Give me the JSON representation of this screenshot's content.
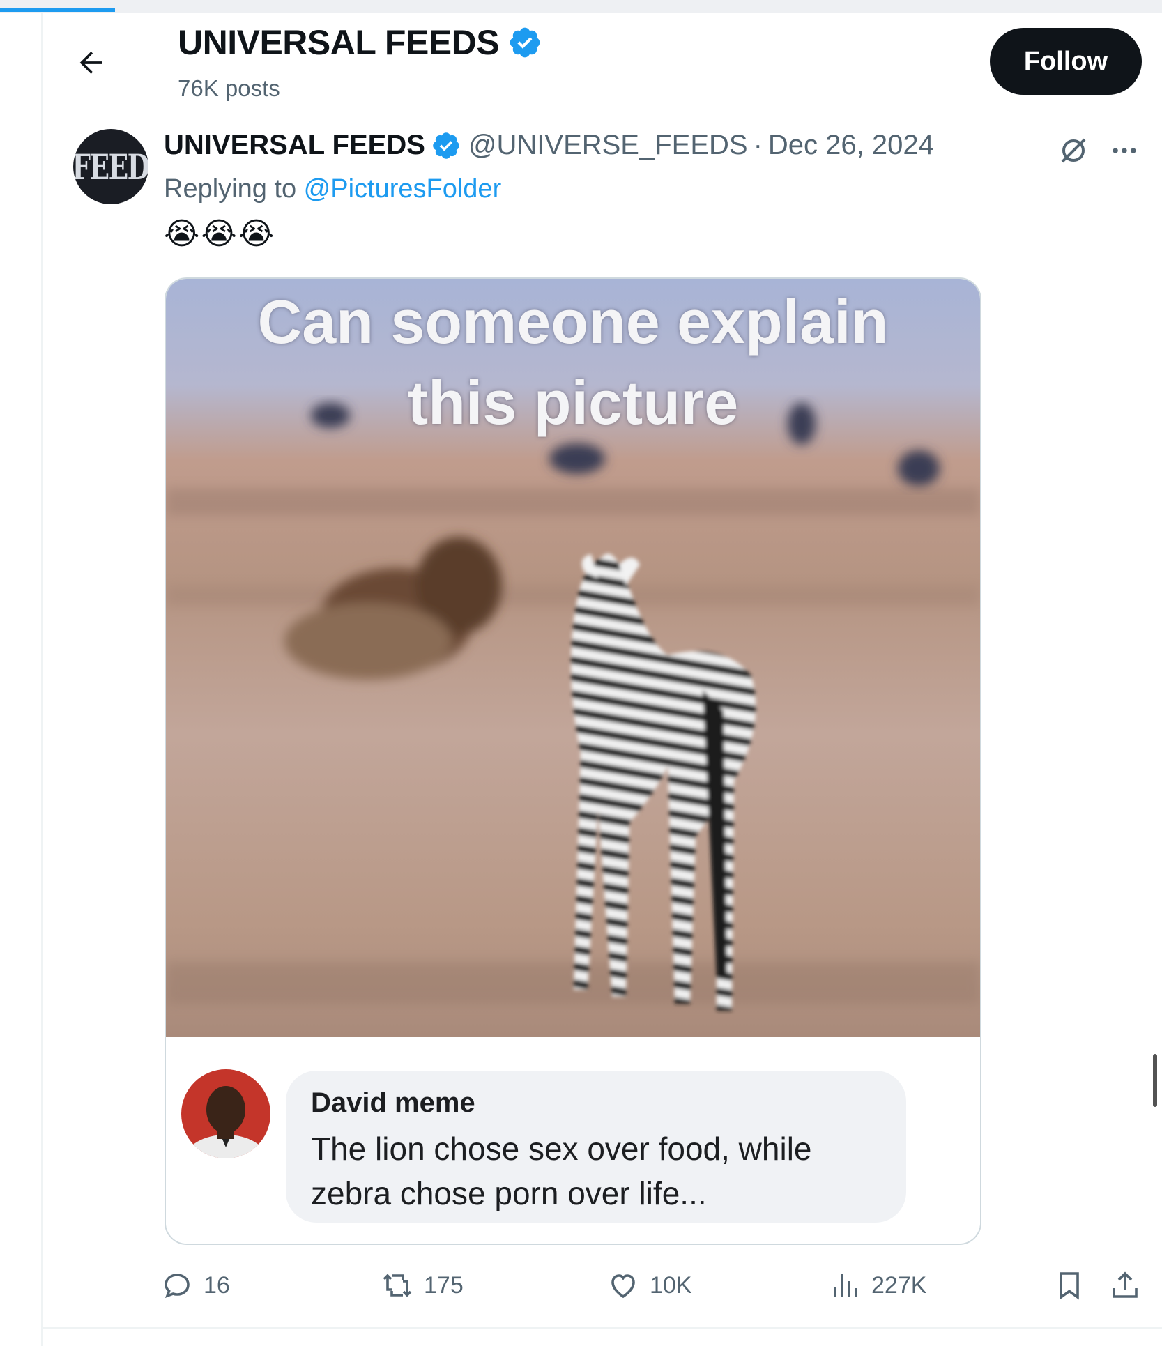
{
  "header": {
    "title": "UNIVERSAL FEEDS",
    "posts_count": "76K posts",
    "follow_label": "Follow"
  },
  "post": {
    "avatar_text": "FEED",
    "author_name": "UNIVERSAL FEEDS",
    "handle": "@UNIVERSE_FEEDS",
    "separator": "·",
    "date": "Dec 26, 2024",
    "replying_prefix": "Replying to ",
    "replying_to": "@PicturesFolder",
    "text": "😭😭😭",
    "media": {
      "caption_line1": "Can someone explain",
      "caption_line2": "this picture",
      "commenter_name": "David meme",
      "comment_text": "The lion chose sex over food, while zebra chose porn over life..."
    },
    "stats": {
      "replies": "16",
      "reposts": "175",
      "likes": "10K",
      "views": "227K"
    }
  },
  "colors": {
    "accent": "#1d9bf0",
    "text_primary": "#0f1419",
    "text_secondary": "#536471",
    "button_dark": "#0f1419",
    "border": "#cfd9de"
  },
  "icons": [
    "back-arrow-icon",
    "verified-badge-icon",
    "grok-icon",
    "more-icon",
    "reply-icon",
    "repost-icon",
    "like-icon",
    "views-icon",
    "bookmark-icon",
    "share-icon"
  ]
}
